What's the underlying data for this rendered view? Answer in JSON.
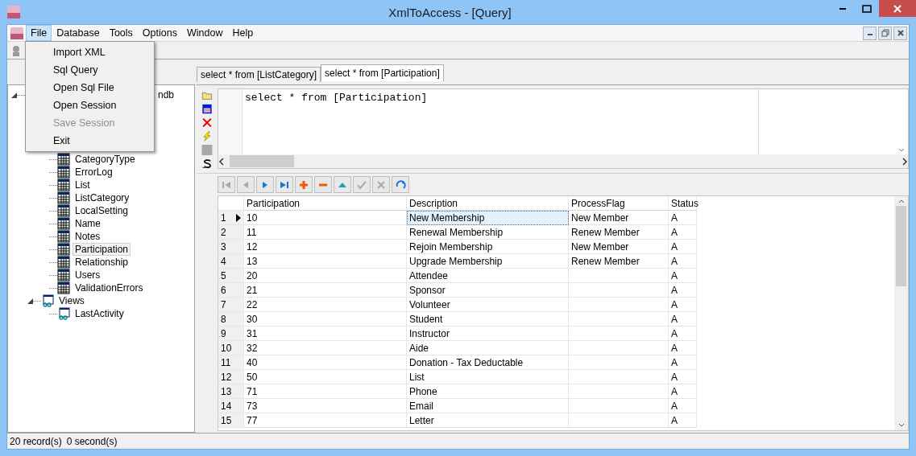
{
  "window": {
    "title": "XmlToAccess - [Query]"
  },
  "menu": [
    {
      "label": "File",
      "selected": true
    },
    {
      "label": "Database",
      "selected": false
    },
    {
      "label": "Tools",
      "selected": false
    },
    {
      "label": "Options",
      "selected": false
    },
    {
      "label": "Window",
      "selected": false
    },
    {
      "label": "Help",
      "selected": false
    }
  ],
  "file_menu": [
    {
      "label": "Import XML",
      "disabled": false
    },
    {
      "label": "Sql Query",
      "disabled": false
    },
    {
      "label": "Open Sql File",
      "disabled": false
    },
    {
      "label": "Open Session",
      "disabled": false
    },
    {
      "label": "Save Session",
      "disabled": true
    },
    {
      "label": "Exit",
      "disabled": false
    }
  ],
  "tree": [
    {
      "kind": "database",
      "label": "ndb",
      "expanded": true,
      "children": [
        {
          "kind": "folder",
          "children": [
            {
              "kind": "table",
              "label": "CategoryType",
              "selected": false
            },
            {
              "kind": "table",
              "label": "ErrorLog",
              "selected": false
            },
            {
              "kind": "table",
              "label": "List",
              "selected": false
            },
            {
              "kind": "table",
              "label": "ListCategory",
              "selected": false
            },
            {
              "kind": "table",
              "label": "LocalSetting",
              "selected": false
            },
            {
              "kind": "table",
              "label": "Name",
              "selected": false
            },
            {
              "kind": "table",
              "label": "Notes",
              "selected": false
            },
            {
              "kind": "table",
              "label": "Participation",
              "selected": true
            },
            {
              "kind": "table",
              "label": "Relationship",
              "selected": false
            },
            {
              "kind": "table",
              "label": "Users",
              "selected": false
            },
            {
              "kind": "table",
              "label": "ValidationErrors",
              "selected": false
            }
          ]
        },
        {
          "kind": "views",
          "label": "Views",
          "expanded": true,
          "children": [
            {
              "kind": "view",
              "label": "LastActivity",
              "selected": false
            }
          ]
        }
      ]
    }
  ],
  "tabs": [
    {
      "label": "select * from [ListCategory]",
      "selected": false
    },
    {
      "label": "select * from [Participation]",
      "selected": true
    }
  ],
  "query_tools": [
    {
      "kind": "open"
    },
    {
      "kind": "save"
    },
    {
      "kind": "delete"
    },
    {
      "kind": "run"
    },
    {
      "kind": "blank"
    },
    {
      "kind": "convert"
    }
  ],
  "editor": {
    "value": "select * from [Participation]"
  },
  "navigator": [
    {
      "kind": "first",
      "disabled": true
    },
    {
      "kind": "prior",
      "disabled": true
    },
    {
      "kind": "next",
      "disabled": false
    },
    {
      "kind": "last",
      "disabled": false
    },
    {
      "kind": "insert",
      "disabled": false
    },
    {
      "kind": "delete",
      "disabled": false
    },
    {
      "kind": "edit",
      "disabled": false
    },
    {
      "kind": "post",
      "disabled": true
    },
    {
      "kind": "cancel",
      "disabled": true
    },
    {
      "kind": "refresh",
      "disabled": false
    }
  ],
  "table": {
    "columns": [
      "Participation",
      "Description",
      "ProcessFlag",
      "Status"
    ],
    "rows": [
      {
        "number": "1",
        "current": true,
        "cells": [
          {
            "text": "10",
            "focused": false
          },
          {
            "text": "New Membership",
            "focused": true
          },
          {
            "text": "New Member",
            "focused": false
          },
          {
            "text": "A",
            "focused": false
          }
        ]
      },
      {
        "number": "2",
        "current": false,
        "cells": [
          {
            "text": "11",
            "focused": false
          },
          {
            "text": "Renewal Membership",
            "focused": false
          },
          {
            "text": "Renew Member",
            "focused": false
          },
          {
            "text": "A",
            "focused": false
          }
        ]
      },
      {
        "number": "3",
        "current": false,
        "cells": [
          {
            "text": "12",
            "focused": false
          },
          {
            "text": "Rejoin Membership",
            "focused": false
          },
          {
            "text": "New Member",
            "focused": false
          },
          {
            "text": "A",
            "focused": false
          }
        ]
      },
      {
        "number": "4",
        "current": false,
        "cells": [
          {
            "text": "13",
            "focused": false
          },
          {
            "text": "Upgrade Membership",
            "focused": false
          },
          {
            "text": "Renew Member",
            "focused": false
          },
          {
            "text": "A",
            "focused": false
          }
        ]
      },
      {
        "number": "5",
        "current": false,
        "cells": [
          {
            "text": "20",
            "focused": false
          },
          {
            "text": "Attendee",
            "focused": false
          },
          {
            "focused": false
          },
          {
            "text": "A",
            "focused": false
          }
        ]
      },
      {
        "number": "6",
        "current": false,
        "cells": [
          {
            "text": "21",
            "focused": false
          },
          {
            "text": "Sponsor",
            "focused": false
          },
          {
            "focused": false
          },
          {
            "text": "A",
            "focused": false
          }
        ]
      },
      {
        "number": "7",
        "current": false,
        "cells": [
          {
            "text": "22",
            "focused": false
          },
          {
            "text": "Volunteer",
            "focused": false
          },
          {
            "focused": false
          },
          {
            "text": "A",
            "focused": false
          }
        ]
      },
      {
        "number": "8",
        "current": false,
        "cells": [
          {
            "text": "30",
            "focused": false
          },
          {
            "text": "Student",
            "focused": false
          },
          {
            "focused": false
          },
          {
            "text": "A",
            "focused": false
          }
        ]
      },
      {
        "number": "9",
        "current": false,
        "cells": [
          {
            "text": "31",
            "focused": false
          },
          {
            "text": "Instructor",
            "focused": false
          },
          {
            "focused": false
          },
          {
            "text": "A",
            "focused": false
          }
        ]
      },
      {
        "number": "10",
        "current": false,
        "cells": [
          {
            "text": "32",
            "focused": false
          },
          {
            "text": "Aide",
            "focused": false
          },
          {
            "focused": false
          },
          {
            "text": "A",
            "focused": false
          }
        ]
      },
      {
        "number": "11",
        "current": false,
        "cells": [
          {
            "text": "40",
            "focused": false
          },
          {
            "text": "Donation - Tax Deductable",
            "focused": false
          },
          {
            "focused": false
          },
          {
            "text": "A",
            "focused": false
          }
        ]
      },
      {
        "number": "12",
        "current": false,
        "cells": [
          {
            "text": "50",
            "focused": false
          },
          {
            "text": "List",
            "focused": false
          },
          {
            "focused": false
          },
          {
            "text": "A",
            "focused": false
          }
        ]
      },
      {
        "number": "13",
        "current": false,
        "cells": [
          {
            "text": "71",
            "focused": false
          },
          {
            "text": "Phone",
            "focused": false
          },
          {
            "focused": false
          },
          {
            "text": "A",
            "focused": false
          }
        ]
      },
      {
        "number": "14",
        "current": false,
        "cells": [
          {
            "text": "73",
            "focused": false
          },
          {
            "text": "Email",
            "focused": false
          },
          {
            "focused": false
          },
          {
            "text": "A",
            "focused": false
          }
        ]
      },
      {
        "number": "15",
        "current": false,
        "cells": [
          {
            "text": "77",
            "focused": false
          },
          {
            "text": "Letter",
            "focused": false
          },
          {
            "focused": false
          },
          {
            "text": "A",
            "focused": false
          }
        ]
      }
    ]
  },
  "status_bar": {
    "records": "20 record(s)",
    "time": "0 second(s)"
  }
}
